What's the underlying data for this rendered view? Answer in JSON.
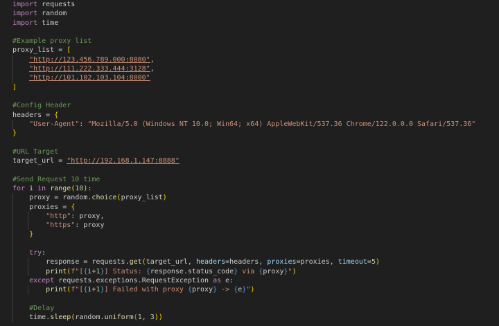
{
  "code": {
    "lines": [
      [
        "import",
        " requests"
      ],
      [
        "import",
        " random"
      ],
      [
        "import",
        " time"
      ],
      [],
      [
        "#Example proxy list"
      ],
      [
        "proxy_list",
        " = ",
        "["
      ],
      [
        "\"http://123.456.789.000:8080\"",
        ","
      ],
      [
        "\"http://111.222.333.444:3128\"",
        ","
      ],
      [
        "\"http://101.102.103.104:8000\""
      ],
      [
        "]"
      ],
      [],
      [
        "#Config Header"
      ],
      [
        "headers",
        " = ",
        "{"
      ],
      [
        "\"User-Agent\"",
        ": ",
        "\"Mozilla/5.0 (Windows NT 10.0; Win64; x64) AppleWebKit/537.36 Chrome/122.0.0.0 Safari/537.36\""
      ],
      [
        "}"
      ],
      [],
      [
        "#URL Target"
      ],
      [
        "target_url",
        " = ",
        "\"http://192.168.1.147:8888\""
      ],
      [],
      [
        "#Send Request 10 time"
      ],
      [
        "for",
        " ",
        "i",
        " ",
        "in",
        " ",
        "range",
        "(",
        "10",
        "):"
      ],
      [
        "proxy",
        " = ",
        "random",
        ".",
        "choice",
        "(",
        "proxy_list",
        ")"
      ],
      [
        "proxies",
        " = ",
        "{"
      ],
      [
        "\"http\"",
        ": ",
        "proxy",
        ","
      ],
      [
        "\"https\"",
        ": ",
        "proxy"
      ],
      [
        "}"
      ],
      [],
      [
        "try",
        ":"
      ],
      [
        "response",
        " = ",
        "requests",
        ".",
        "get",
        "(",
        "target_url",
        ", ",
        "headers",
        "=",
        "headers",
        ", ",
        "proxies",
        "=",
        "proxies",
        ", ",
        "timeout",
        "=",
        "5",
        ")"
      ],
      [
        "print",
        "(",
        "f\"[",
        "{",
        "i",
        "+",
        "1",
        "}",
        "] Status: ",
        "{",
        "response",
        ".",
        "status_code",
        "}",
        " via ",
        "{",
        "proxy",
        "}",
        "\"",
        ")"
      ],
      [
        "except",
        " ",
        "requests",
        ".",
        "exceptions",
        ".",
        "RequestException",
        " ",
        "as",
        " ",
        "e",
        ":"
      ],
      [
        "print",
        "(",
        "f\"[",
        "{",
        "i",
        "+",
        "1",
        "}",
        "] Failed with proxy ",
        "{",
        "proxy",
        "}",
        " -> ",
        "{",
        "e",
        "}",
        "\"",
        ")"
      ],
      [],
      [
        "#Delay"
      ],
      [
        "time",
        ".",
        "sleep",
        "(",
        "random",
        ".",
        "uniform",
        "(",
        "1",
        ", ",
        "3",
        "))"
      ]
    ]
  },
  "colors": {
    "background": "#1f1f1f",
    "keyword": "#c586c0",
    "comment": "#6a9955",
    "string": "#ce9178",
    "function": "#dcdcaa",
    "variable": "#9cdcfe",
    "number": "#b5cea8",
    "bracket_level_1": "#ffd700",
    "bracket_level_2": "#da70d6",
    "bracket_level_3": "#179fff"
  }
}
